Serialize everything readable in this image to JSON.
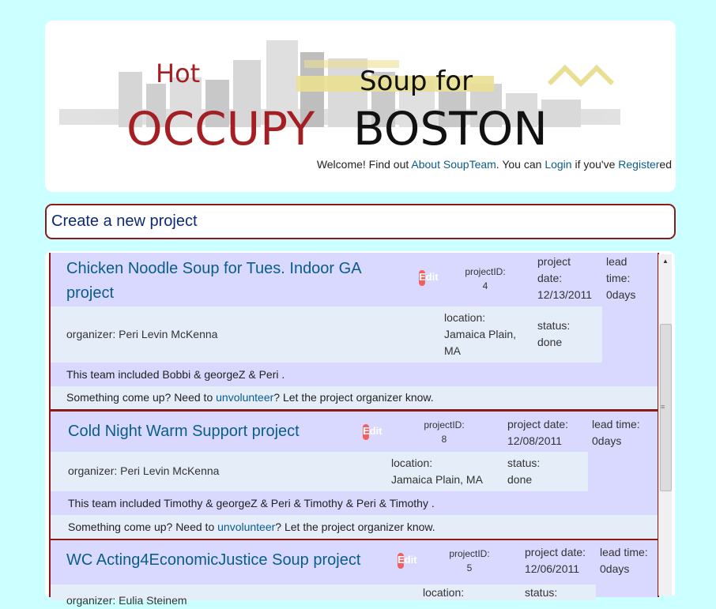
{
  "header": {
    "logo_hot": "Hot",
    "logo_occupy": "OCCUPY",
    "logo_soupfor": "Soup for",
    "logo_boston": "BOSTON",
    "welcome_prefix": "Welcome! Find out ",
    "about_link": "About SoupTeam",
    "welcome_mid": ". You can ",
    "login_link": "Login",
    "welcome_if": " if you've ",
    "register_link": "Register",
    "welcome_suffix": "ed"
  },
  "create_project": {
    "label": "Create a new project"
  },
  "projects": [
    {
      "title": "Chicken Noodle Soup for Tues. Indoor GA project",
      "edit_label": "Edit",
      "project_id_label": "projectID:",
      "project_id": "4",
      "date_label": "project date:",
      "date": "12/13/2011",
      "lead_label": "lead time:",
      "lead": "0days",
      "organizer": "organizer: Peri Levin McKenna",
      "location_label": "location:",
      "location": "Jamaica Plain, MA",
      "status_label": "status:",
      "status": "done",
      "team": "This team included Bobbi & georgeZ & Peri .",
      "unvol_prefix": "Something come up? Need to ",
      "unvol_link": "unvolunteer",
      "unvol_suffix": "? Let the project organizer know."
    },
    {
      "title": "Cold Night Warm Support project",
      "edit_label": "Edit",
      "project_id_label": "projectID:",
      "project_id": "8",
      "date_label": "project date:",
      "date": "12/08/2011",
      "lead_label": "lead time:",
      "lead": "0days",
      "organizer": "organizer: Peri Levin McKenna",
      "location_label": "location:",
      "location": "Jamaica Plain, MA",
      "status_label": "status:",
      "status": "done",
      "team": "This team included Timothy & georgeZ & Peri & Timothy & Peri & Timothy .",
      "unvol_prefix": "Something come up? Need to ",
      "unvol_link": "unvolunteer",
      "unvol_suffix": "? Let the project organizer know."
    },
    {
      "title": "WC Acting4EconomicJustice Soup project",
      "edit_label": "Edit",
      "project_id_label": "projectID:",
      "project_id": "5",
      "date_label": "project date:",
      "date": "12/06/2011",
      "lead_label": "lead time:",
      "lead": "0days",
      "organizer_partial": "organizer: Eulia Steinem",
      "location_label": "location:",
      "status_label": "status:"
    }
  ],
  "colors": {
    "background": "#ccffff",
    "card": "#d9d9ff",
    "row": "#e4edf8",
    "border": "#8b1a1a",
    "link": "#0a5c8a",
    "edit": "#f06060"
  }
}
